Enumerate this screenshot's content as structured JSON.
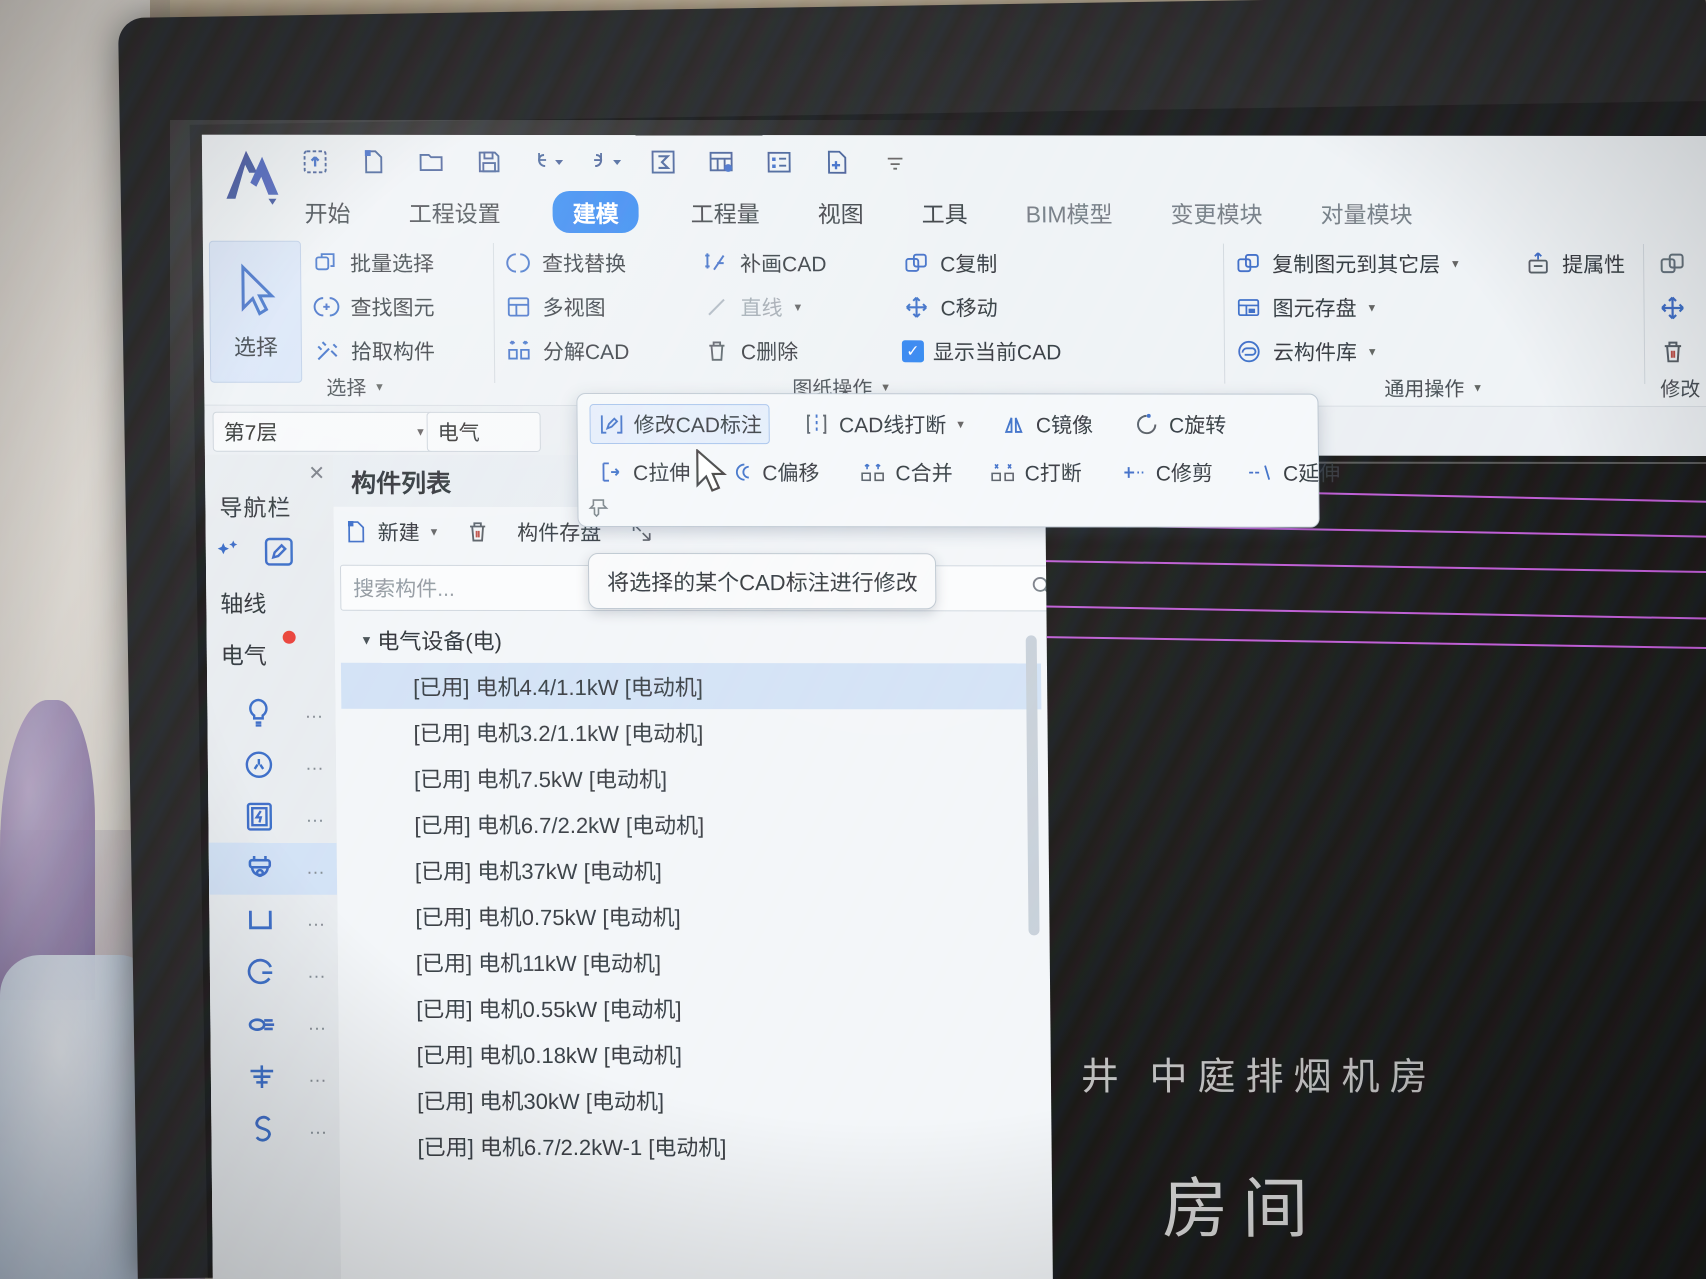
{
  "quick_access": [
    {
      "name": "upload-icon",
      "label": "上传"
    },
    {
      "name": "new-file-icon",
      "label": "新建"
    },
    {
      "name": "open-folder-icon",
      "label": "打开"
    },
    {
      "name": "save-icon",
      "label": "保存"
    },
    {
      "name": "undo-icon",
      "label": "撤销"
    },
    {
      "name": "redo-icon",
      "label": "恢复"
    },
    {
      "name": "sum-icon",
      "label": "汇总"
    },
    {
      "name": "table-icon",
      "label": "报表"
    },
    {
      "name": "properties-icon",
      "label": "属性"
    },
    {
      "name": "add-page-icon",
      "label": "添加"
    },
    {
      "name": "more-icon",
      "label": "更多"
    }
  ],
  "tabs": [
    {
      "label": "开始",
      "active": false
    },
    {
      "label": "工程设置",
      "active": false
    },
    {
      "label": "建模",
      "active": true
    },
    {
      "label": "工程量",
      "active": false
    },
    {
      "label": "视图",
      "active": false
    },
    {
      "label": "工具",
      "active": false
    },
    {
      "label": "BIM模型",
      "active": false
    },
    {
      "label": "变更模块",
      "active": false
    },
    {
      "label": "对量模块",
      "active": false
    }
  ],
  "ribbon": {
    "select_button": {
      "label": "选择",
      "icon": "cursor-arrow-icon"
    },
    "group_select": {
      "label": "选择",
      "items": [
        {
          "label": "批量选择",
          "icon": "batch-select-icon"
        },
        {
          "label": "查找图元",
          "icon": "find-element-icon"
        },
        {
          "label": "拾取构件",
          "icon": "pick-component-icon"
        }
      ]
    },
    "group_drawing": {
      "label": "图纸操作",
      "col1": [
        {
          "label": "查找替换",
          "icon": "find-replace-icon"
        },
        {
          "label": "多视图",
          "icon": "multi-view-icon"
        },
        {
          "label": "分解CAD",
          "icon": "explode-cad-icon"
        }
      ],
      "col2": [
        {
          "label": "补画CAD",
          "icon": "draw-cad-icon"
        },
        {
          "label": "直线",
          "icon": "line-icon",
          "disabled": true,
          "caret": true
        },
        {
          "label": "C删除",
          "icon": "trash-icon"
        }
      ],
      "col3": [
        {
          "label": "C复制",
          "icon": "copy-icon"
        },
        {
          "label": "C移动",
          "icon": "move-icon"
        },
        {
          "label": "显示当前CAD",
          "icon": "checkbox-checked-icon",
          "checked": true
        }
      ]
    },
    "group_common": {
      "label": "通用操作",
      "col1": [
        {
          "label": "复制图元到其它层",
          "icon": "copy-to-layer-icon",
          "caret": true
        },
        {
          "label": "图元存盘",
          "icon": "save-element-icon",
          "caret": true
        },
        {
          "label": "云构件库",
          "icon": "cloud-library-icon",
          "caret": true
        }
      ],
      "col2": [
        {
          "label": "提属性",
          "icon": "extract-property-icon"
        }
      ]
    },
    "group_modify": {
      "label": "修改",
      "icons": [
        {
          "name": "copy-icon"
        },
        {
          "name": "move-icon"
        },
        {
          "name": "delete-icon"
        }
      ]
    }
  },
  "flyout": {
    "row1": [
      {
        "label": "修改CAD标注",
        "icon": "modify-cad-dim-icon",
        "selected": true
      },
      {
        "label": "CAD线打断",
        "icon": "cad-line-break-icon",
        "caret": true
      },
      {
        "label": "C镜像",
        "icon": "mirror-icon"
      },
      {
        "label": "C旋转",
        "icon": "rotate-icon"
      }
    ],
    "row2": [
      {
        "label": "C拉伸",
        "icon": "stretch-icon"
      },
      {
        "label": "C偏移",
        "icon": "offset-icon"
      },
      {
        "label": "C合并",
        "icon": "merge-icon"
      },
      {
        "label": "C打断",
        "icon": "break-icon"
      },
      {
        "label": "C修剪",
        "icon": "trim-icon"
      },
      {
        "label": "C延伸",
        "icon": "extend-icon"
      }
    ],
    "pin_icon": "pin-icon"
  },
  "tooltip": {
    "text": "将选择的某个CAD标注进行修改"
  },
  "layer_bar": {
    "floor": {
      "value": "第7层",
      "caret": "▾"
    },
    "discipline": {
      "value": "电气"
    }
  },
  "nav_panel": {
    "title": "导航栏",
    "close_icon": "close-icon",
    "tools": [
      {
        "name": "magic-select-icon"
      },
      {
        "name": "edit-pencil-icon"
      }
    ],
    "sections": [
      {
        "label": "轴线",
        "badge": false
      },
      {
        "label": "电气",
        "badge": true
      }
    ],
    "items": [
      {
        "icon": "lamp-icon",
        "active": false
      },
      {
        "icon": "socket-icon",
        "active": false
      },
      {
        "icon": "distribution-box-icon",
        "active": false
      },
      {
        "icon": "electrical-equipment-icon",
        "active": true
      },
      {
        "icon": "cable-tray-icon",
        "active": false
      },
      {
        "icon": "conduit-icon",
        "active": false
      },
      {
        "icon": "wiring-icon",
        "active": false
      },
      {
        "icon": "bridge-icon",
        "active": false
      },
      {
        "icon": "line-s-icon",
        "active": false
      }
    ],
    "dots_label": "…"
  },
  "component_list": {
    "title": "构件列表",
    "toolbar": [
      {
        "label": "新建",
        "icon": "new-doc-icon",
        "caret": true
      },
      {
        "label": "删除",
        "icon": "delete-icon"
      },
      {
        "label": "构件存盘",
        "icon": "save-component-icon"
      },
      {
        "label": "",
        "icon": "expand-icon"
      }
    ],
    "search_placeholder": "搜索构件...",
    "search_icon": "search-icon",
    "group": {
      "label": "电气设备(电)",
      "expanded": true,
      "triangle": "▾"
    },
    "items": [
      {
        "label": "[已用] 电机4.4/1.1kW [电动机]",
        "selected": true
      },
      {
        "label": "[已用] 电机3.2/1.1kW [电动机]",
        "selected": false
      },
      {
        "label": "[已用] 电机7.5kW [电动机]",
        "selected": false
      },
      {
        "label": "[已用] 电机6.7/2.2kW [电动机]",
        "selected": false
      },
      {
        "label": "[已用] 电机37kW [电动机]",
        "selected": false
      },
      {
        "label": "[已用] 电机0.75kW [电动机]",
        "selected": false
      },
      {
        "label": "[已用] 电机11kW [电动机]",
        "selected": false
      },
      {
        "label": "[已用] 电机0.55kW [电动机]",
        "selected": false
      },
      {
        "label": "[已用] 电机0.18kW [电动机]",
        "selected": false
      },
      {
        "label": "[已用] 电机30kW [电动机]",
        "selected": false
      },
      {
        "label": "[已用] 电机6.7/2.2kW-1 [电动机]",
        "selected": false
      }
    ]
  },
  "canvas": {
    "texts": [
      {
        "text": "井 中庭排烟机房",
        "size": "normal"
      },
      {
        "text": "房间",
        "size": "big"
      }
    ],
    "line_color": "#b84fd0"
  }
}
